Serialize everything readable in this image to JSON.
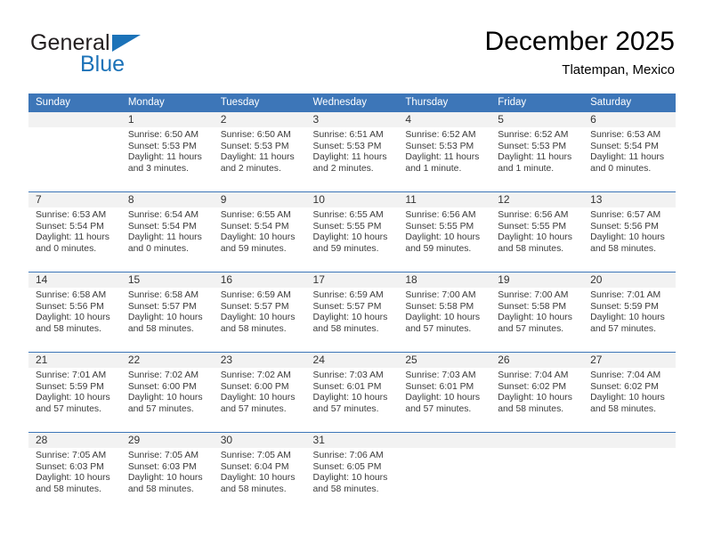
{
  "brand": {
    "name_top": "General",
    "name_bottom": "Blue",
    "accent_color": "#1b72b8"
  },
  "header": {
    "title": "December 2025",
    "subtitle": "Tlatempan, Mexico"
  },
  "calendar": {
    "header_bg": "#3d76b8",
    "daynum_bg": "#f2f2f2",
    "weekdays": [
      "Sunday",
      "Monday",
      "Tuesday",
      "Wednesday",
      "Thursday",
      "Friday",
      "Saturday"
    ],
    "weeks": [
      [
        {
          "day": "",
          "sunrise": "",
          "sunset": "",
          "daylight": "",
          "daylight2": ""
        },
        {
          "day": "1",
          "sunrise": "Sunrise: 6:50 AM",
          "sunset": "Sunset: 5:53 PM",
          "daylight": "Daylight: 11 hours",
          "daylight2": "and 3 minutes."
        },
        {
          "day": "2",
          "sunrise": "Sunrise: 6:50 AM",
          "sunset": "Sunset: 5:53 PM",
          "daylight": "Daylight: 11 hours",
          "daylight2": "and 2 minutes."
        },
        {
          "day": "3",
          "sunrise": "Sunrise: 6:51 AM",
          "sunset": "Sunset: 5:53 PM",
          "daylight": "Daylight: 11 hours",
          "daylight2": "and 2 minutes."
        },
        {
          "day": "4",
          "sunrise": "Sunrise: 6:52 AM",
          "sunset": "Sunset: 5:53 PM",
          "daylight": "Daylight: 11 hours",
          "daylight2": "and 1 minute."
        },
        {
          "day": "5",
          "sunrise": "Sunrise: 6:52 AM",
          "sunset": "Sunset: 5:53 PM",
          "daylight": "Daylight: 11 hours",
          "daylight2": "and 1 minute."
        },
        {
          "day": "6",
          "sunrise": "Sunrise: 6:53 AM",
          "sunset": "Sunset: 5:54 PM",
          "daylight": "Daylight: 11 hours",
          "daylight2": "and 0 minutes."
        }
      ],
      [
        {
          "day": "7",
          "sunrise": "Sunrise: 6:53 AM",
          "sunset": "Sunset: 5:54 PM",
          "daylight": "Daylight: 11 hours",
          "daylight2": "and 0 minutes."
        },
        {
          "day": "8",
          "sunrise": "Sunrise: 6:54 AM",
          "sunset": "Sunset: 5:54 PM",
          "daylight": "Daylight: 11 hours",
          "daylight2": "and 0 minutes."
        },
        {
          "day": "9",
          "sunrise": "Sunrise: 6:55 AM",
          "sunset": "Sunset: 5:54 PM",
          "daylight": "Daylight: 10 hours",
          "daylight2": "and 59 minutes."
        },
        {
          "day": "10",
          "sunrise": "Sunrise: 6:55 AM",
          "sunset": "Sunset: 5:55 PM",
          "daylight": "Daylight: 10 hours",
          "daylight2": "and 59 minutes."
        },
        {
          "day": "11",
          "sunrise": "Sunrise: 6:56 AM",
          "sunset": "Sunset: 5:55 PM",
          "daylight": "Daylight: 10 hours",
          "daylight2": "and 59 minutes."
        },
        {
          "day": "12",
          "sunrise": "Sunrise: 6:56 AM",
          "sunset": "Sunset: 5:55 PM",
          "daylight": "Daylight: 10 hours",
          "daylight2": "and 58 minutes."
        },
        {
          "day": "13",
          "sunrise": "Sunrise: 6:57 AM",
          "sunset": "Sunset: 5:56 PM",
          "daylight": "Daylight: 10 hours",
          "daylight2": "and 58 minutes."
        }
      ],
      [
        {
          "day": "14",
          "sunrise": "Sunrise: 6:58 AM",
          "sunset": "Sunset: 5:56 PM",
          "daylight": "Daylight: 10 hours",
          "daylight2": "and 58 minutes."
        },
        {
          "day": "15",
          "sunrise": "Sunrise: 6:58 AM",
          "sunset": "Sunset: 5:57 PM",
          "daylight": "Daylight: 10 hours",
          "daylight2": "and 58 minutes."
        },
        {
          "day": "16",
          "sunrise": "Sunrise: 6:59 AM",
          "sunset": "Sunset: 5:57 PM",
          "daylight": "Daylight: 10 hours",
          "daylight2": "and 58 minutes."
        },
        {
          "day": "17",
          "sunrise": "Sunrise: 6:59 AM",
          "sunset": "Sunset: 5:57 PM",
          "daylight": "Daylight: 10 hours",
          "daylight2": "and 58 minutes."
        },
        {
          "day": "18",
          "sunrise": "Sunrise: 7:00 AM",
          "sunset": "Sunset: 5:58 PM",
          "daylight": "Daylight: 10 hours",
          "daylight2": "and 57 minutes."
        },
        {
          "day": "19",
          "sunrise": "Sunrise: 7:00 AM",
          "sunset": "Sunset: 5:58 PM",
          "daylight": "Daylight: 10 hours",
          "daylight2": "and 57 minutes."
        },
        {
          "day": "20",
          "sunrise": "Sunrise: 7:01 AM",
          "sunset": "Sunset: 5:59 PM",
          "daylight": "Daylight: 10 hours",
          "daylight2": "and 57 minutes."
        }
      ],
      [
        {
          "day": "21",
          "sunrise": "Sunrise: 7:01 AM",
          "sunset": "Sunset: 5:59 PM",
          "daylight": "Daylight: 10 hours",
          "daylight2": "and 57 minutes."
        },
        {
          "day": "22",
          "sunrise": "Sunrise: 7:02 AM",
          "sunset": "Sunset: 6:00 PM",
          "daylight": "Daylight: 10 hours",
          "daylight2": "and 57 minutes."
        },
        {
          "day": "23",
          "sunrise": "Sunrise: 7:02 AM",
          "sunset": "Sunset: 6:00 PM",
          "daylight": "Daylight: 10 hours",
          "daylight2": "and 57 minutes."
        },
        {
          "day": "24",
          "sunrise": "Sunrise: 7:03 AM",
          "sunset": "Sunset: 6:01 PM",
          "daylight": "Daylight: 10 hours",
          "daylight2": "and 57 minutes."
        },
        {
          "day": "25",
          "sunrise": "Sunrise: 7:03 AM",
          "sunset": "Sunset: 6:01 PM",
          "daylight": "Daylight: 10 hours",
          "daylight2": "and 57 minutes."
        },
        {
          "day": "26",
          "sunrise": "Sunrise: 7:04 AM",
          "sunset": "Sunset: 6:02 PM",
          "daylight": "Daylight: 10 hours",
          "daylight2": "and 58 minutes."
        },
        {
          "day": "27",
          "sunrise": "Sunrise: 7:04 AM",
          "sunset": "Sunset: 6:02 PM",
          "daylight": "Daylight: 10 hours",
          "daylight2": "and 58 minutes."
        }
      ],
      [
        {
          "day": "28",
          "sunrise": "Sunrise: 7:05 AM",
          "sunset": "Sunset: 6:03 PM",
          "daylight": "Daylight: 10 hours",
          "daylight2": "and 58 minutes."
        },
        {
          "day": "29",
          "sunrise": "Sunrise: 7:05 AM",
          "sunset": "Sunset: 6:03 PM",
          "daylight": "Daylight: 10 hours",
          "daylight2": "and 58 minutes."
        },
        {
          "day": "30",
          "sunrise": "Sunrise: 7:05 AM",
          "sunset": "Sunset: 6:04 PM",
          "daylight": "Daylight: 10 hours",
          "daylight2": "and 58 minutes."
        },
        {
          "day": "31",
          "sunrise": "Sunrise: 7:06 AM",
          "sunset": "Sunset: 6:05 PM",
          "daylight": "Daylight: 10 hours",
          "daylight2": "and 58 minutes."
        },
        {
          "day": "",
          "sunrise": "",
          "sunset": "",
          "daylight": "",
          "daylight2": ""
        },
        {
          "day": "",
          "sunrise": "",
          "sunset": "",
          "daylight": "",
          "daylight2": ""
        },
        {
          "day": "",
          "sunrise": "",
          "sunset": "",
          "daylight": "",
          "daylight2": ""
        }
      ]
    ]
  }
}
